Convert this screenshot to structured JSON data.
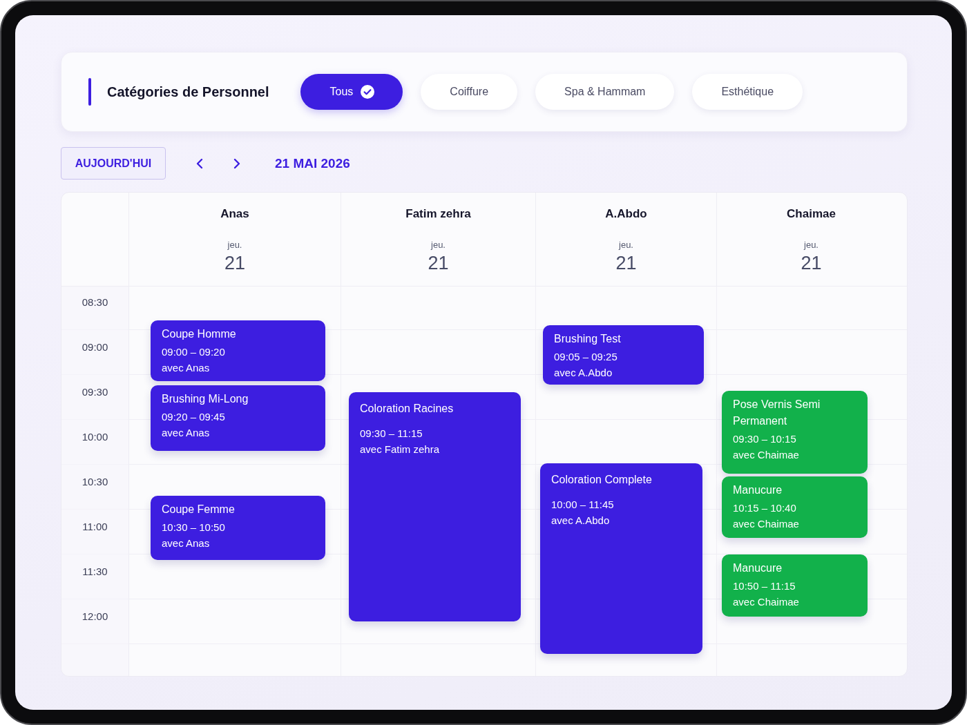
{
  "categories": {
    "title": "Catégories de Personnel",
    "filters": [
      {
        "label": "Tous",
        "selected": true
      },
      {
        "label": "Coiffure",
        "selected": false
      },
      {
        "label": "Spa & Hammam",
        "selected": false
      },
      {
        "label": "Esthétique",
        "selected": false
      }
    ]
  },
  "navigation": {
    "today_button": "AUJOURD'HUI",
    "date": "21 MAI 2026"
  },
  "calendar": {
    "time_slots": [
      "08:30",
      "09:00",
      "09:30",
      "10:00",
      "10:30",
      "11:00",
      "11:30",
      "12:00"
    ],
    "columns": [
      {
        "name": "Anas",
        "weekday": "jeu.",
        "day": "21",
        "events": [
          {
            "title": "Coupe Homme",
            "time": "09:00 – 09:20",
            "staff": "avec Anas",
            "color": "#3d1ee0"
          },
          {
            "title": "Brushing Mi-Long",
            "time": "09:20 – 09:45",
            "staff": "avec Anas",
            "color": "#3d1ee0"
          },
          {
            "title": "Coupe Femme",
            "time": "10:30 – 10:50",
            "staff": "avec Anas",
            "color": "#3d1ee0"
          }
        ]
      },
      {
        "name": "Fatim zehra",
        "weekday": "jeu.",
        "day": "21",
        "events": [
          {
            "title": "Coloration Racines",
            "time": "09:30 – 11:15",
            "staff": "avec Fatim zehra",
            "color": "#3d1ee0"
          }
        ]
      },
      {
        "name": "A.Abdo",
        "weekday": "jeu.",
        "day": "21",
        "events": [
          {
            "title": "Brushing Test",
            "time": "09:05 – 09:25",
            "staff": "avec A.Abdo",
            "color": "#3d1ee0"
          },
          {
            "title": "Coloration Complete",
            "time": "10:00 – 11:45",
            "staff": "avec A.Abdo",
            "color": "#3d1ee0"
          }
        ]
      },
      {
        "name": "Chaimae",
        "weekday": "jeu.",
        "day": "21",
        "events": [
          {
            "title": "Pose Vernis Semi Permanent",
            "time": "09:30 – 10:15",
            "staff": "avec Chaimae",
            "color": "#12b14b"
          },
          {
            "title": "Manucure",
            "time": "10:15 – 10:40",
            "staff": "avec Chaimae",
            "color": "#12b14b"
          },
          {
            "title": "Manucure",
            "time": "10:50 – 11:15",
            "staff": "avec Chaimae",
            "color": "#12b14b"
          }
        ]
      }
    ]
  }
}
